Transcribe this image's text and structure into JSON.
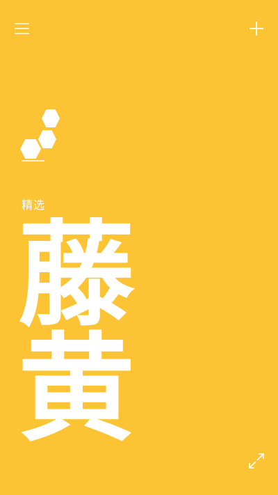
{
  "theme": {
    "background": "#fcc434",
    "foreground": "#ffffff"
  },
  "toolbar": {
    "menu_icon": "hamburger-menu-icon",
    "add_icon": "plus-icon"
  },
  "logo": {
    "icon": "hexagon-cluster-logo"
  },
  "content": {
    "category": "精选",
    "title_chars": [
      "藤",
      "黄"
    ]
  },
  "footer": {
    "expand_icon": "expand-arrows-icon"
  }
}
